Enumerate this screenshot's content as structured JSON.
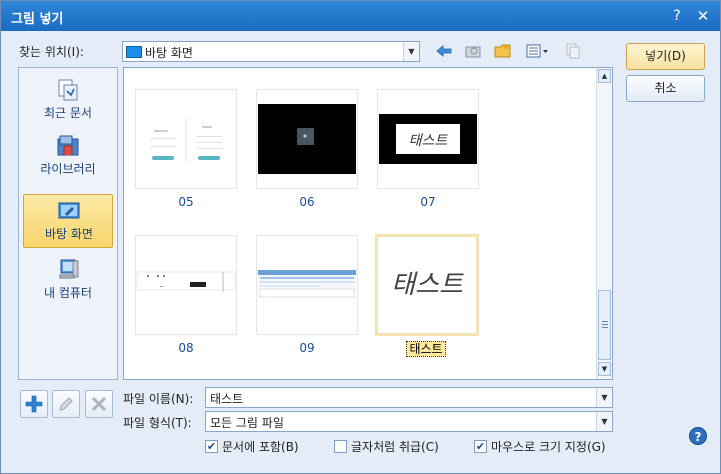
{
  "window": {
    "title": "그림 넣기",
    "help_glyph": "?",
    "close_glyph": "✕"
  },
  "look_in": {
    "label": "찾는 위치(I):",
    "value": "바탕 화면"
  },
  "places": [
    {
      "label": "최근 문서",
      "icon": "recent-docs-icon"
    },
    {
      "label": "라이브러리",
      "icon": "library-icon"
    },
    {
      "label": "바탕 화면",
      "icon": "desktop-icon",
      "selected": true
    },
    {
      "label": "내 컴퓨터",
      "icon": "computer-icon"
    }
  ],
  "files": [
    {
      "name": "05"
    },
    {
      "name": "06"
    },
    {
      "name": "07",
      "thumb_text": "태스트"
    },
    {
      "name": "08"
    },
    {
      "name": "09"
    },
    {
      "name": "태스트",
      "thumb_text": "태스트",
      "selected": true
    }
  ],
  "file_name": {
    "label": "파일 이름(N):",
    "value": "태스트"
  },
  "file_type": {
    "label": "파일 형식(T):",
    "value": "모든 그림 파일"
  },
  "options": [
    {
      "label": "문서에 포함(B)",
      "checked": true
    },
    {
      "label": "글자처럼 취급(C)",
      "checked": false
    },
    {
      "label": "마우스로 크기 지정(G)",
      "checked": true
    }
  ],
  "buttons": {
    "insert": "넣기(D)",
    "cancel": "취소"
  },
  "help": "?"
}
